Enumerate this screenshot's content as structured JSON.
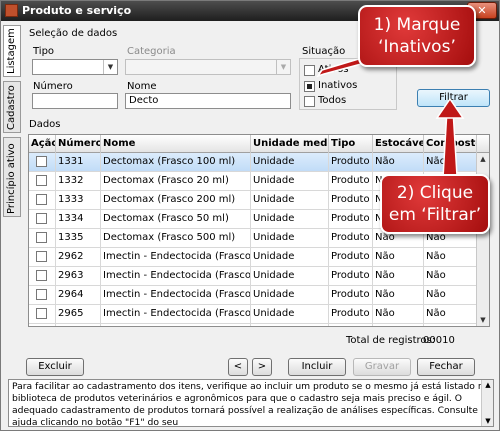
{
  "window": {
    "title": "Produto e serviço",
    "close_glyph": "✕"
  },
  "vtabs": [
    "Listagem",
    "Cadastro",
    "Princípio ativo"
  ],
  "selecao": {
    "group_label": "Seleção de dados",
    "tipo_label": "Tipo",
    "categoria_label": "Categoria",
    "numero_label": "Número",
    "numero_value": "",
    "nome_label": "Nome",
    "nome_value": "Decto",
    "situacao_label": "Situação",
    "situacao_options": [
      {
        "label": "Ativos",
        "checked": false
      },
      {
        "label": "Inativos",
        "checked": true
      },
      {
        "label": "Todos",
        "checked": false
      }
    ],
    "filtrar_label": "Filtrar"
  },
  "dados": {
    "group_label": "Dados",
    "columns": [
      "Ação",
      "Número",
      "Nome",
      "Unidade medida",
      "Tipo",
      "Estocável",
      "Composto"
    ],
    "rows": [
      {
        "numero": "1331",
        "nome": "Dectomax (Frasco 100 ml)",
        "unidade": "Unidade",
        "tipo": "Produto",
        "estocavel": "Não",
        "composto": "Não"
      },
      {
        "numero": "1332",
        "nome": "Dectomax (Frasco 20 ml)",
        "unidade": "Unidade",
        "tipo": "Produto",
        "estocavel": "Não",
        "composto": "Não"
      },
      {
        "numero": "1333",
        "nome": "Dectomax (Frasco 200 ml)",
        "unidade": "Unidade",
        "tipo": "Produto",
        "estocavel": "Não",
        "composto": "Não"
      },
      {
        "numero": "1334",
        "nome": "Dectomax (Frasco 50 ml)",
        "unidade": "Unidade",
        "tipo": "Produto",
        "estocavel": "Não",
        "composto": "Não"
      },
      {
        "numero": "1335",
        "nome": "Dectomax (Frasco 500 ml)",
        "unidade": "Unidade",
        "tipo": "Produto",
        "estocavel": "Não",
        "composto": "Não"
      },
      {
        "numero": "2962",
        "nome": "Imectin - Endectocida (Frasco 10 ml)",
        "unidade": "Unidade",
        "tipo": "Produto",
        "estocavel": "Não",
        "composto": "Não"
      },
      {
        "numero": "2963",
        "nome": "Imectin - Endectocida (Frasco 1000 m",
        "unidade": "Unidade",
        "tipo": "Produto",
        "estocavel": "Não",
        "composto": "Não"
      },
      {
        "numero": "2964",
        "nome": "Imectin - Endectocida (Frasco 50 ml)",
        "unidade": "Unidade",
        "tipo": "Produto",
        "estocavel": "Não",
        "composto": "Não"
      },
      {
        "numero": "2965",
        "nome": "Imectin - Endectocida (Frasco 500 ml",
        "unidade": "Unidade",
        "tipo": "Produto",
        "estocavel": "Não",
        "composto": "Não"
      },
      {
        "numero": "3405",
        "nome": "Ivosint - Endectocida Para Bovinos (F",
        "unidade": "Unidade",
        "tipo": "Produto",
        "estocavel": "Não",
        "composto": "Não"
      }
    ],
    "total_label": "Total de registros:",
    "total_value": "00010"
  },
  "buttons": {
    "excluir": "Excluir",
    "prev": "<",
    "next": ">",
    "incluir": "Incluir",
    "gravar": "Gravar",
    "fechar": "Fechar"
  },
  "help_text": "Para facilitar ao cadastramento dos itens, verifique ao incluir um produto se o mesmo já está listado na biblioteca de produtos veterinários e agronômicos para que o cadastro seja mais preciso e ágil. O adequado cadastramento de produtos tornará possível a realização de análises específicas. Consulte a ajuda clicando no botão \"F1\" do seu",
  "callouts": [
    {
      "line1": "1) Marque",
      "line2": "‘Inativos’"
    },
    {
      "line1": "2) Clique",
      "line2": "em ‘Filtrar’"
    }
  ],
  "colors": {
    "callout": "#c01818",
    "title_bar": "#2b2b2b",
    "selected_row": "#c8e0f8"
  }
}
